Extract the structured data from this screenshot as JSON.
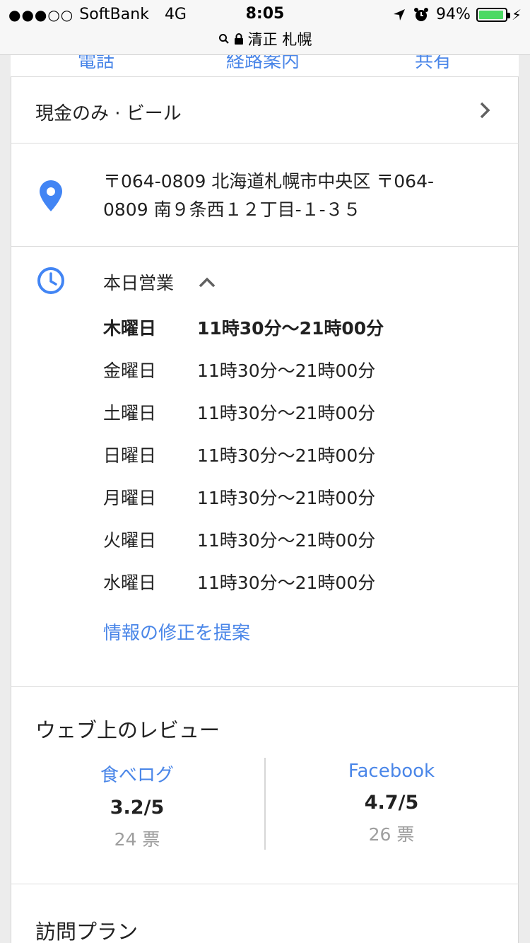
{
  "status_bar": {
    "signal_dots": "●●●○○",
    "carrier": "SoftBank",
    "network": "4G",
    "time": "8:05",
    "battery_percent": "94%",
    "battery_level": 0.94,
    "icons": [
      "location-arrow-icon",
      "alarm-icon",
      "battery-icon",
      "charging-bolt-icon"
    ]
  },
  "url_bar": {
    "title": "清正 札幌",
    "icons": [
      "search-icon",
      "lock-icon"
    ]
  },
  "features": {
    "label": "現金のみ · ビール",
    "icon": "chevron-right-icon"
  },
  "address": {
    "text": "〒064-0809 北海道札幌市中央区 〒064-0809 南９条西１２丁目-１-３５",
    "icon": "location-pin-icon",
    "color": "#4285f4"
  },
  "hours": {
    "heading": "本日営業",
    "icon": "clock-icon",
    "rows": [
      {
        "day": "木曜日",
        "time": "11時30分〜21時00分"
      },
      {
        "day": "金曜日",
        "time": "11時30分〜21時00分"
      },
      {
        "day": "土曜日",
        "time": "11時30分〜21時00分"
      },
      {
        "day": "日曜日",
        "time": "11時30分〜21時00分"
      },
      {
        "day": "月曜日",
        "time": "11時30分〜21時00分"
      },
      {
        "day": "火曜日",
        "time": "11時30分〜21時00分"
      },
      {
        "day": "水曜日",
        "time": "11時30分〜21時00分"
      }
    ],
    "suggest_edit": "情報の修正を提案"
  },
  "reviews": {
    "title": "ウェブ上のレビュー",
    "sources": [
      {
        "name": "食べログ",
        "score": "3.2/5",
        "votes": "24 票"
      },
      {
        "name": "Facebook",
        "score": "4.7/5",
        "votes": "26 票"
      }
    ]
  },
  "visit_plan": {
    "title": "訪問プラン"
  },
  "colors": {
    "link": "#4a86e8",
    "battery": "#4cd964"
  }
}
